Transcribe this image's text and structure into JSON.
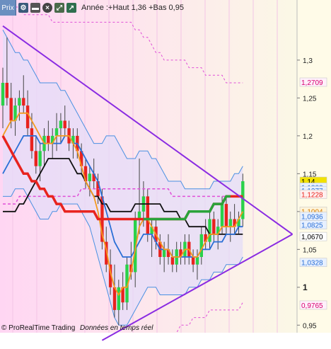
{
  "toolbar": {
    "tab_label": "Prix",
    "title": "Année :+Haut 1,36 +Bas 0,95"
  },
  "footer": {
    "copyright": "© ProRealTime Trading",
    "realtime": "Données en temps réel"
  },
  "colors": {
    "bollinger_fill": "#e4dcf8",
    "bollinger_band": "#4a90e2",
    "upper_band_pink": "#e04fd8",
    "triangle": "#8a2be2",
    "ma_red": "#e8231e",
    "ma_green": "#2aa33a",
    "ma_black": "#111111",
    "ma_blue": "#2a6fd6",
    "ma_orange": "#f39a1e",
    "ma_pink_dashed": "#e04fd8",
    "axis_bg": "#fffbe8",
    "chart_bg_left": "#ffd6f3",
    "chart_bg_right": "#fbfbe6"
  },
  "chart_data": {
    "type": "candlestick",
    "y_axis_ticks": [
      "1,3",
      "1,25",
      "1,2",
      "1,15",
      "1,1",
      "1,05",
      "1",
      "0,95"
    ],
    "ylim": [
      0.94,
      1.37
    ],
    "price_labels": [
      {
        "text": "1,2709",
        "value": 1.2709,
        "color": "#d6006f",
        "bg": "#fff0fb"
      },
      {
        "text": "1,14",
        "value": 1.14,
        "color": "#000",
        "bg": "#f2e200"
      },
      {
        "text": "1,1322",
        "value": 1.1322,
        "color": "#2a6fd6",
        "bg": "#e7f0ff"
      },
      {
        "text": "1,1277",
        "value": 1.1277,
        "color": "#2a6fd6",
        "bg": "#e7f0ff"
      },
      {
        "text": "1,1228",
        "value": 1.1228,
        "color": "#e8231e",
        "bg": "#fff0ef"
      },
      {
        "text": "1,1004",
        "value": 1.1004,
        "color": "#d67a00",
        "bg": "#fff4d9"
      },
      {
        "text": "1,0936",
        "value": 1.0936,
        "color": "#2a6fd6",
        "bg": "#e7f0ff"
      },
      {
        "text": "1,0825",
        "value": 1.0825,
        "color": "#2a6fd6",
        "bg": "#e7f0ff"
      },
      {
        "text": "1,0670",
        "value": 1.067,
        "color": "#000",
        "bg": "#ffffff"
      },
      {
        "text": "1,0328",
        "value": 1.0328,
        "color": "#2a6fd6",
        "bg": "#e7f0ff"
      },
      {
        "text": "0,9765",
        "value": 0.9765,
        "color": "#d6006f",
        "bg": "#fff0fb"
      }
    ],
    "candles": [
      {
        "o": 1.24,
        "h": 1.29,
        "l": 1.21,
        "c": 1.27
      },
      {
        "o": 1.27,
        "h": 1.33,
        "l": 1.24,
        "c": 1.25
      },
      {
        "o": 1.25,
        "h": 1.27,
        "l": 1.21,
        "c": 1.22
      },
      {
        "o": 1.22,
        "h": 1.25,
        "l": 1.2,
        "c": 1.24
      },
      {
        "o": 1.24,
        "h": 1.26,
        "l": 1.22,
        "c": 1.25
      },
      {
        "o": 1.25,
        "h": 1.28,
        "l": 1.23,
        "c": 1.24
      },
      {
        "o": 1.24,
        "h": 1.26,
        "l": 1.2,
        "c": 1.21
      },
      {
        "o": 1.21,
        "h": 1.23,
        "l": 1.17,
        "c": 1.18
      },
      {
        "o": 1.18,
        "h": 1.2,
        "l": 1.15,
        "c": 1.16
      },
      {
        "o": 1.16,
        "h": 1.19,
        "l": 1.14,
        "c": 1.18
      },
      {
        "o": 1.18,
        "h": 1.21,
        "l": 1.16,
        "c": 1.2
      },
      {
        "o": 1.2,
        "h": 1.22,
        "l": 1.18,
        "c": 1.19
      },
      {
        "o": 1.19,
        "h": 1.21,
        "l": 1.17,
        "c": 1.2
      },
      {
        "o": 1.2,
        "h": 1.23,
        "l": 1.18,
        "c": 1.21
      },
      {
        "o": 1.21,
        "h": 1.23,
        "l": 1.19,
        "c": 1.22
      },
      {
        "o": 1.22,
        "h": 1.24,
        "l": 1.2,
        "c": 1.21
      },
      {
        "o": 1.21,
        "h": 1.22,
        "l": 1.18,
        "c": 1.19
      },
      {
        "o": 1.19,
        "h": 1.21,
        "l": 1.17,
        "c": 1.2
      },
      {
        "o": 1.2,
        "h": 1.21,
        "l": 1.17,
        "c": 1.18
      },
      {
        "o": 1.18,
        "h": 1.19,
        "l": 1.15,
        "c": 1.16
      },
      {
        "o": 1.16,
        "h": 1.17,
        "l": 1.13,
        "c": 1.14
      },
      {
        "o": 1.14,
        "h": 1.16,
        "l": 1.12,
        "c": 1.15
      },
      {
        "o": 1.15,
        "h": 1.17,
        "l": 1.13,
        "c": 1.14
      },
      {
        "o": 1.14,
        "h": 1.15,
        "l": 1.11,
        "c": 1.12
      },
      {
        "o": 1.12,
        "h": 1.13,
        "l": 1.05,
        "c": 1.06
      },
      {
        "o": 1.06,
        "h": 1.08,
        "l": 1.02,
        "c": 1.03
      },
      {
        "o": 1.03,
        "h": 1.05,
        "l": 0.99,
        "c": 1.0
      },
      {
        "o": 1.0,
        "h": 1.03,
        "l": 0.96,
        "c": 0.97
      },
      {
        "o": 0.97,
        "h": 1.01,
        "l": 0.95,
        "c": 1.0
      },
      {
        "o": 1.0,
        "h": 1.02,
        "l": 0.97,
        "c": 0.98
      },
      {
        "o": 0.98,
        "h": 1.04,
        "l": 0.97,
        "c": 1.03
      },
      {
        "o": 1.03,
        "h": 1.06,
        "l": 1.01,
        "c": 1.02
      },
      {
        "o": 1.02,
        "h": 1.1,
        "l": 1.0,
        "c": 1.09
      },
      {
        "o": 1.09,
        "h": 1.17,
        "l": 1.07,
        "c": 1.1
      },
      {
        "o": 1.1,
        "h": 1.14,
        "l": 1.08,
        "c": 1.12
      },
      {
        "o": 1.12,
        "h": 1.13,
        "l": 1.06,
        "c": 1.07
      },
      {
        "o": 1.07,
        "h": 1.09,
        "l": 1.04,
        "c": 1.08
      },
      {
        "o": 1.08,
        "h": 1.09,
        "l": 1.05,
        "c": 1.06
      },
      {
        "o": 1.06,
        "h": 1.07,
        "l": 1.03,
        "c": 1.04
      },
      {
        "o": 1.04,
        "h": 1.06,
        "l": 1.02,
        "c": 1.05
      },
      {
        "o": 1.05,
        "h": 1.07,
        "l": 1.03,
        "c": 1.04
      },
      {
        "o": 1.04,
        "h": 1.05,
        "l": 1.02,
        "c": 1.03
      },
      {
        "o": 1.03,
        "h": 1.06,
        "l": 1.02,
        "c": 1.05
      },
      {
        "o": 1.05,
        "h": 1.06,
        "l": 1.03,
        "c": 1.04
      },
      {
        "o": 1.04,
        "h": 1.07,
        "l": 1.03,
        "c": 1.06
      },
      {
        "o": 1.06,
        "h": 1.07,
        "l": 1.03,
        "c": 1.04
      },
      {
        "o": 1.04,
        "h": 1.05,
        "l": 1.02,
        "c": 1.03
      },
      {
        "o": 1.03,
        "h": 1.05,
        "l": 1.01,
        "c": 1.04
      },
      {
        "o": 1.04,
        "h": 1.08,
        "l": 1.03,
        "c": 1.07
      },
      {
        "o": 1.07,
        "h": 1.09,
        "l": 1.05,
        "c": 1.06
      },
      {
        "o": 1.06,
        "h": 1.1,
        "l": 1.05,
        "c": 1.09
      },
      {
        "o": 1.09,
        "h": 1.1,
        "l": 1.06,
        "c": 1.07
      },
      {
        "o": 1.07,
        "h": 1.09,
        "l": 1.05,
        "c": 1.08
      },
      {
        "o": 1.08,
        "h": 1.12,
        "l": 1.07,
        "c": 1.11
      },
      {
        "o": 1.11,
        "h": 1.12,
        "l": 1.07,
        "c": 1.08
      },
      {
        "o": 1.08,
        "h": 1.1,
        "l": 1.06,
        "c": 1.09
      },
      {
        "o": 1.09,
        "h": 1.11,
        "l": 1.07,
        "c": 1.08
      },
      {
        "o": 1.08,
        "h": 1.1,
        "l": 1.07,
        "c": 1.09
      },
      {
        "o": 1.09,
        "h": 1.15,
        "l": 1.08,
        "c": 1.14
      }
    ],
    "bollinger_upper": [
      1.34,
      1.33,
      1.32,
      1.31,
      1.31,
      1.3,
      1.3,
      1.29,
      1.28,
      1.27,
      1.27,
      1.27,
      1.27,
      1.27,
      1.26,
      1.26,
      1.25,
      1.24,
      1.23,
      1.22,
      1.21,
      1.2,
      1.19,
      1.19,
      1.19,
      1.2,
      1.2,
      1.2,
      1.19,
      1.18,
      1.17,
      1.17,
      1.17,
      1.18,
      1.18,
      1.18,
      1.17,
      1.17,
      1.16,
      1.15,
      1.14,
      1.14,
      1.14,
      1.14,
      1.13,
      1.13,
      1.13,
      1.13,
      1.13,
      1.13,
      1.13,
      1.14,
      1.14,
      1.14,
      1.14,
      1.14,
      1.15,
      1.15,
      1.16
    ],
    "bollinger_lower": [
      1.12,
      1.12,
      1.12,
      1.13,
      1.13,
      1.13,
      1.12,
      1.11,
      1.1,
      1.09,
      1.09,
      1.09,
      1.1,
      1.1,
      1.11,
      1.11,
      1.11,
      1.11,
      1.11,
      1.1,
      1.09,
      1.08,
      1.06,
      1.04,
      1.02,
      1.0,
      0.98,
      0.96,
      0.95,
      0.95,
      0.95,
      0.96,
      0.97,
      0.98,
      0.99,
      1.0,
      1.0,
      1.0,
      0.99,
      0.99,
      0.99,
      0.99,
      0.99,
      0.99,
      0.99,
      1.0,
      1.0,
      1.0,
      1.01,
      1.01,
      1.01,
      1.02,
      1.02,
      1.02,
      1.03,
      1.03,
      1.03,
      1.03,
      1.04
    ],
    "ma_red": [
      1.2,
      1.19,
      1.18,
      1.17,
      1.16,
      1.15,
      1.15,
      1.14,
      1.14,
      1.13,
      1.13,
      1.12,
      1.12,
      1.11,
      1.11,
      1.1,
      1.1,
      1.1,
      1.1,
      1.1,
      1.1,
      1.1,
      1.1,
      1.09,
      1.09,
      1.09,
      1.09,
      1.09,
      1.09,
      1.09,
      1.09,
      1.09,
      1.09,
      1.09,
      1.09,
      1.09,
      1.09,
      1.09,
      1.09,
      1.09,
      1.09,
      1.09,
      1.09,
      1.09,
      1.09,
      1.1,
      1.1,
      1.1,
      1.1,
      1.1,
      1.1,
      1.11,
      1.11,
      1.11,
      1.12,
      1.12,
      1.12,
      1.12,
      1.12
    ],
    "ma_green_segment_start": 34,
    "ma_black": [
      1.1,
      1.1,
      1.1,
      1.1,
      1.11,
      1.11,
      1.12,
      1.13,
      1.14,
      1.15,
      1.16,
      1.17,
      1.17,
      1.17,
      1.17,
      1.17,
      1.17,
      1.16,
      1.15,
      1.15,
      1.14,
      1.13,
      1.12,
      1.12,
      1.11,
      1.11,
      1.1,
      1.1,
      1.1,
      1.1,
      1.1,
      1.1,
      1.11,
      1.11,
      1.11,
      1.11,
      1.11,
      1.11,
      1.11,
      1.1,
      1.1,
      1.1,
      1.1,
      1.09,
      1.09,
      1.08,
      1.08,
      1.08,
      1.08,
      1.08,
      1.07,
      1.07,
      1.07,
      1.07,
      1.07,
      1.07,
      1.07,
      1.07,
      1.07
    ],
    "ma_blue": [
      1.15,
      1.16,
      1.17,
      1.18,
      1.19,
      1.2,
      1.2,
      1.2,
      1.2,
      1.19,
      1.19,
      1.19,
      1.19,
      1.19,
      1.19,
      1.2,
      1.2,
      1.19,
      1.19,
      1.18,
      1.17,
      1.16,
      1.15,
      1.14,
      1.12,
      1.1,
      1.08,
      1.06,
      1.05,
      1.04,
      1.04,
      1.04,
      1.05,
      1.06,
      1.07,
      1.07,
      1.07,
      1.06,
      1.05,
      1.05,
      1.05,
      1.04,
      1.04,
      1.04,
      1.04,
      1.04,
      1.04,
      1.04,
      1.05,
      1.05,
      1.05,
      1.06,
      1.06,
      1.06,
      1.07,
      1.07,
      1.07,
      1.08,
      1.08
    ],
    "ma_orange": [
      1.2,
      1.21,
      1.22,
      1.22,
      1.23,
      1.23,
      1.23,
      1.22,
      1.21,
      1.2,
      1.19,
      1.19,
      1.19,
      1.2,
      1.2,
      1.2,
      1.2,
      1.19,
      1.18,
      1.16,
      1.14,
      1.13,
      1.12,
      1.1,
      1.07,
      1.05,
      1.02,
      1.0,
      0.99,
      1.0,
      1.0,
      1.02,
      1.05,
      1.08,
      1.09,
      1.09,
      1.08,
      1.07,
      1.06,
      1.05,
      1.05,
      1.04,
      1.04,
      1.04,
      1.05,
      1.05,
      1.04,
      1.04,
      1.05,
      1.06,
      1.07,
      1.07,
      1.07,
      1.08,
      1.08,
      1.08,
      1.08,
      1.09,
      1.1
    ],
    "ma_pink": [
      1.11,
      1.11,
      1.11,
      1.11,
      1.12,
      1.12,
      1.12,
      1.12,
      1.12,
      1.12,
      1.12,
      1.12,
      1.12,
      1.12,
      1.12,
      1.12,
      1.12,
      1.12,
      1.12,
      1.13,
      1.13,
      1.13,
      1.13,
      1.13,
      1.13,
      1.13,
      1.13,
      1.13,
      1.13,
      1.13,
      1.13,
      1.13,
      1.13,
      1.13,
      1.13,
      1.13,
      1.13,
      1.13,
      1.13,
      1.13,
      1.13,
      1.12,
      1.12,
      1.12,
      1.12,
      1.12,
      1.12,
      1.12,
      1.12,
      1.12,
      1.12,
      1.12,
      1.12,
      1.12,
      1.12,
      1.12,
      1.12,
      1.12,
      1.12
    ],
    "upper_pink_band": [
      1.37,
      1.37,
      1.37,
      1.37,
      1.37,
      1.36,
      1.36,
      1.36,
      1.36,
      1.36,
      1.36,
      1.36,
      1.35,
      1.35,
      1.35,
      1.35,
      1.35,
      1.35,
      1.35,
      1.35,
      1.35,
      1.35,
      1.35,
      1.35,
      1.35,
      1.35,
      1.35,
      1.35,
      1.35,
      1.35,
      1.35,
      1.35,
      1.34,
      1.34,
      1.33,
      1.33,
      1.32,
      1.31,
      1.31,
      1.3,
      1.3,
      1.3,
      1.3,
      1.3,
      1.3,
      1.29,
      1.29,
      1.29,
      1.29,
      1.28,
      1.28,
      1.28,
      1.28,
      1.28,
      1.27,
      1.27,
      1.27,
      1.27,
      1.27
    ],
    "lower_pink_band": [
      0.9,
      0.9,
      0.9,
      0.9,
      0.9,
      0.9,
      0.9,
      0.9,
      0.9,
      0.9,
      0.9,
      0.9,
      0.9,
      0.9,
      0.9,
      0.9,
      0.9,
      0.9,
      0.9,
      0.9,
      0.9,
      0.9,
      0.9,
      0.9,
      0.9,
      0.9,
      0.9,
      0.9,
      0.9,
      0.9,
      0.9,
      0.9,
      0.9,
      0.9,
      0.9,
      0.9,
      0.9,
      0.9,
      0.9,
      0.9,
      0.92,
      0.93,
      0.94,
      0.95,
      0.95,
      0.95,
      0.96,
      0.96,
      0.96,
      0.96,
      0.97,
      0.97,
      0.97,
      0.97,
      0.97,
      0.97,
      0.97,
      0.97,
      0.98
    ],
    "triangle_upper_line": {
      "from": {
        "i": 0,
        "v": 1.345
      },
      "to": {
        "i": 70,
        "v": 1.07
      }
    },
    "triangle_lower_line": {
      "from": {
        "i": 24,
        "v": 0.93
      },
      "to": {
        "i": 70,
        "v": 1.07
      }
    }
  }
}
